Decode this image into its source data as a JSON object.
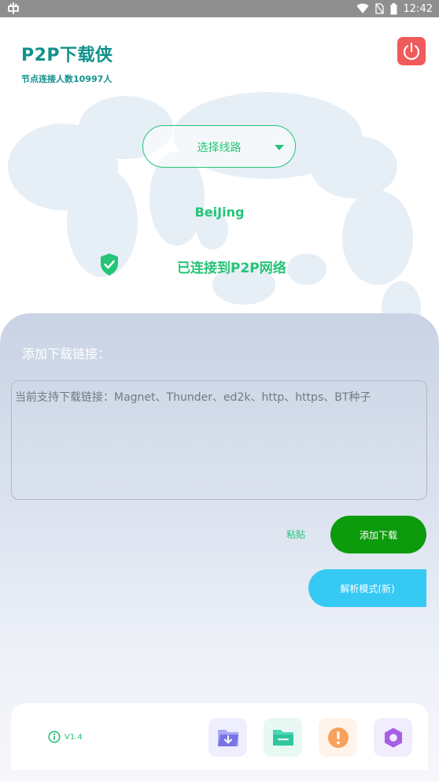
{
  "status_bar": {
    "time": "12:42"
  },
  "header": {
    "title": "P2P下载侠",
    "node_count": "节点连接人数10997人"
  },
  "route": {
    "select_label": "选择线路",
    "city": "BeiJing",
    "connection_status": "已连接到P2P网络"
  },
  "download": {
    "section_label": "添加下载链接：",
    "input_placeholder": "当前支持下载链接：Magnet、Thunder、ed2k、http、https、BT种子",
    "input_value": "",
    "paste_label": "粘贴",
    "add_label": "添加下载",
    "parse_label": "解析模式(新)"
  },
  "bottom_bar": {
    "version": "V1.4",
    "nav_icons": [
      "download-folder-icon",
      "folder-icon",
      "alert-icon",
      "settings-icon"
    ]
  },
  "colors": {
    "accent_green": "#25c477",
    "title_teal": "#12908a",
    "power_red": "#f05a5a",
    "add_button": "#0c9b0c",
    "parse_button": "#36c9f4"
  }
}
